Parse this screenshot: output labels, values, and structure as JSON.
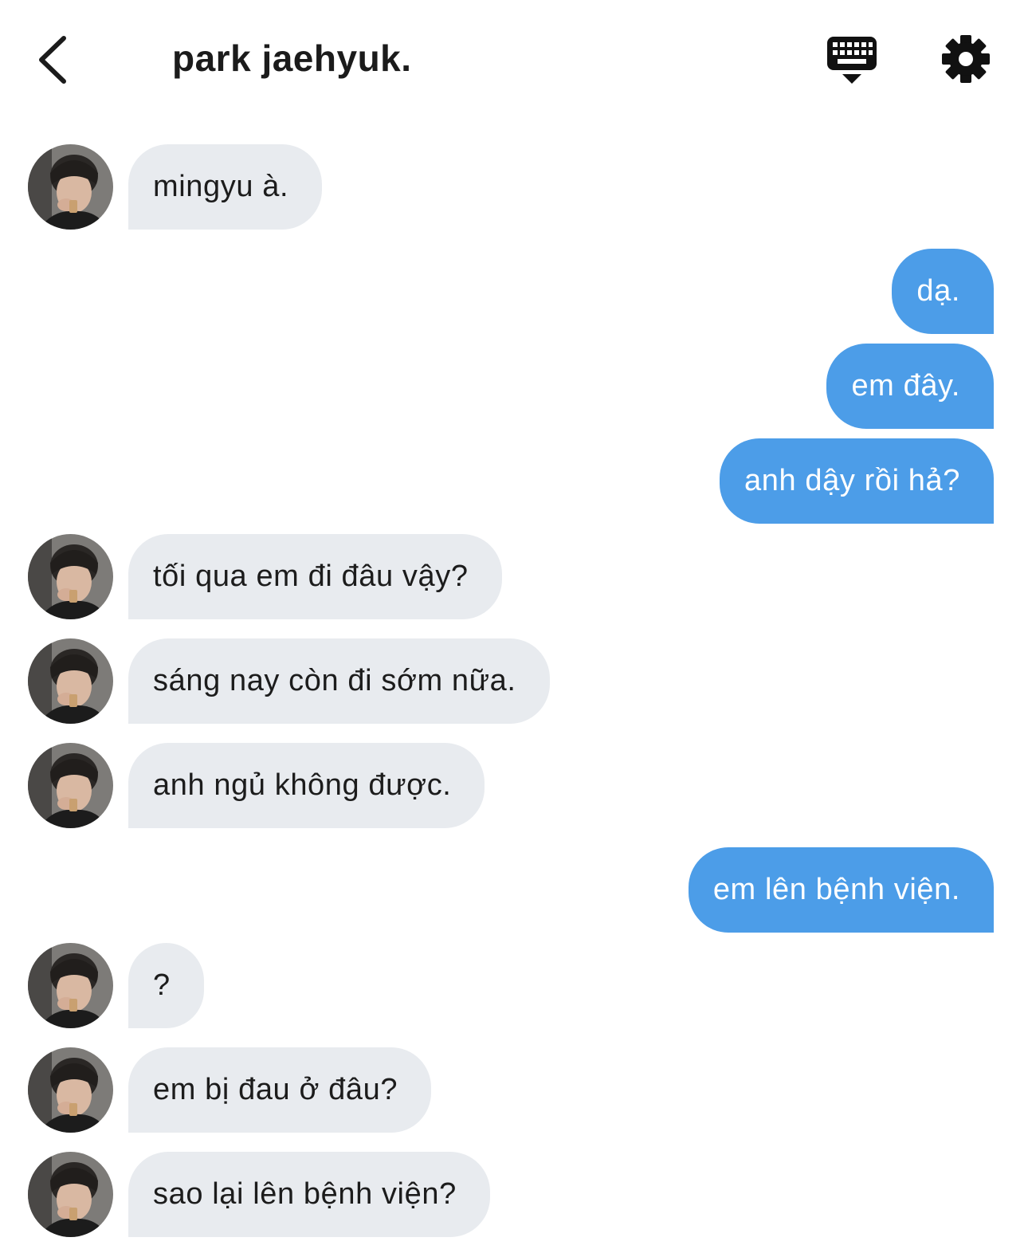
{
  "header": {
    "title": "park jaehyuk."
  },
  "icons": {
    "back": "chevron-left-icon",
    "keyboard": "keyboard-hide-icon",
    "settings": "gear-icon"
  },
  "colors": {
    "incoming_bubble": "#e8ebef",
    "outgoing_bubble": "#4c9de8",
    "incoming_text": "#1c1c1c",
    "outgoing_text": "#ffffff"
  },
  "messages": [
    {
      "sender": "park jaehyuk.",
      "direction": "incoming",
      "text": "mingyu à."
    },
    {
      "sender": "me",
      "direction": "outgoing",
      "text": "dạ."
    },
    {
      "sender": "me",
      "direction": "outgoing",
      "text": "em đây."
    },
    {
      "sender": "me",
      "direction": "outgoing",
      "text": "anh dậy rồi hả?"
    },
    {
      "sender": "park jaehyuk.",
      "direction": "incoming",
      "text": "tối qua em đi đâu vậy?"
    },
    {
      "sender": "park jaehyuk.",
      "direction": "incoming",
      "text": "sáng nay còn đi sớm nữa."
    },
    {
      "sender": "park jaehyuk.",
      "direction": "incoming",
      "text": "anh ngủ không được."
    },
    {
      "sender": "me",
      "direction": "outgoing",
      "text": "em lên bệnh viện."
    },
    {
      "sender": "park jaehyuk.",
      "direction": "incoming",
      "text": "?"
    },
    {
      "sender": "park jaehyuk.",
      "direction": "incoming",
      "text": "em bị đau ở đâu?"
    },
    {
      "sender": "park jaehyuk.",
      "direction": "incoming",
      "text": "sao lại lên bệnh viện?"
    }
  ]
}
